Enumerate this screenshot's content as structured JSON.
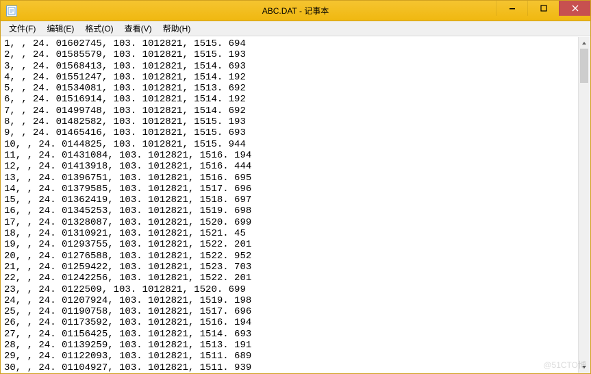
{
  "window": {
    "title": "ABC.DAT - 记事本"
  },
  "menubar": {
    "items": [
      {
        "label": "文件(F)"
      },
      {
        "label": "编辑(E)"
      },
      {
        "label": "格式(O)"
      },
      {
        "label": "查看(V)"
      },
      {
        "label": "帮助(H)"
      }
    ]
  },
  "content": {
    "lines": [
      "1, , 24. 01602745, 103. 1012821, 1515. 694",
      "2, , 24. 01585579, 103. 1012821, 1515. 193",
      "3, , 24. 01568413, 103. 1012821, 1514. 693",
      "4, , 24. 01551247, 103. 1012821, 1514. 192",
      "5, , 24. 01534081, 103. 1012821, 1513. 692",
      "6, , 24. 01516914, 103. 1012821, 1514. 192",
      "7, , 24. 01499748, 103. 1012821, 1514. 692",
      "8, , 24. 01482582, 103. 1012821, 1515. 193",
      "9, , 24. 01465416, 103. 1012821, 1515. 693",
      "10, , 24. 0144825, 103. 1012821, 1515. 944",
      "11, , 24. 01431084, 103. 1012821, 1516. 194",
      "12, , 24. 01413918, 103. 1012821, 1516. 444",
      "13, , 24. 01396751, 103. 1012821, 1516. 695",
      "14, , 24. 01379585, 103. 1012821, 1517. 696",
      "15, , 24. 01362419, 103. 1012821, 1518. 697",
      "16, , 24. 01345253, 103. 1012821, 1519. 698",
      "17, , 24. 01328087, 103. 1012821, 1520. 699",
      "18, , 24. 01310921, 103. 1012821, 1521. 45",
      "19, , 24. 01293755, 103. 1012821, 1522. 201",
      "20, , 24. 01276588, 103. 1012821, 1522. 952",
      "21, , 24. 01259422, 103. 1012821, 1523. 703",
      "22, , 24. 01242256, 103. 1012821, 1522. 201",
      "23, , 24. 0122509, 103. 1012821, 1520. 699",
      "24, , 24. 01207924, 103. 1012821, 1519. 198",
      "25, , 24. 01190758, 103. 1012821, 1517. 696",
      "26, , 24. 01173592, 103. 1012821, 1516. 194",
      "27, , 24. 01156425, 103. 1012821, 1514. 693",
      "28, , 24. 01139259, 103. 1012821, 1513. 191",
      "29, , 24. 01122093, 103. 1012821, 1511. 689",
      "30, , 24. 01104927, 103. 1012821, 1511. 939"
    ]
  },
  "watermark": "@51CTO博"
}
